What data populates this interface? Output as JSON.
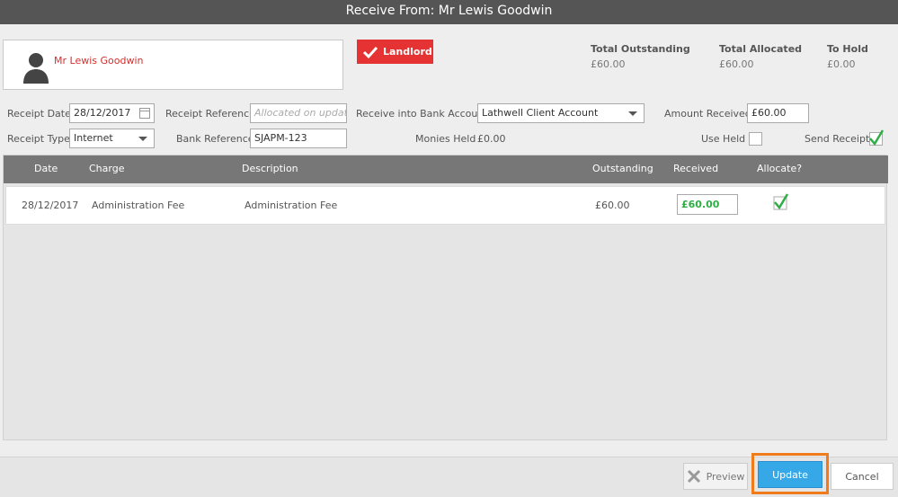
{
  "title": "Receive From: Mr Lewis Goodwin",
  "contact": {
    "name": "Mr Lewis Goodwin",
    "role_badge": "Landlord"
  },
  "summary": {
    "total_outstanding": {
      "label": "Total Outstanding",
      "value": "£60.00"
    },
    "total_allocated": {
      "label": "Total Allocated",
      "value": "£60.00"
    },
    "to_hold": {
      "label": "To Hold",
      "value": "£0.00"
    }
  },
  "form": {
    "receipt_date": {
      "label": "Receipt Date",
      "value": "28/12/2017"
    },
    "receipt_reference": {
      "label": "Receipt Reference",
      "placeholder": "Allocated on update"
    },
    "bank_account": {
      "label": "Receive into Bank Account",
      "value": "Lathwell Client Account"
    },
    "amount_received": {
      "label": "Amount Received",
      "value": "£60.00"
    },
    "receipt_type": {
      "label": "Receipt Type",
      "value": "Internet"
    },
    "bank_reference": {
      "label": "Bank Reference",
      "value": "SJAPM-123"
    },
    "monies_held": {
      "label": "Monies Held",
      "value": "£0.00"
    },
    "use_held": {
      "label": "Use Held",
      "checked": false
    },
    "send_receipt": {
      "label": "Send Receipt",
      "checked": true
    }
  },
  "table": {
    "columns": [
      "Date",
      "Charge",
      "Description",
      "Outstanding",
      "Received",
      "Allocate?"
    ],
    "rows": [
      {
        "date": "28/12/2017",
        "charge": "Administration Fee",
        "description": "Administration Fee",
        "outstanding": "£60.00",
        "received": "£60.00",
        "allocate": true
      }
    ]
  },
  "buttons": {
    "preview": "Preview",
    "update": "Update",
    "cancel": "Cancel"
  },
  "colors": {
    "accent": "#36a8e8",
    "badge": "#e53333",
    "highlight": "#f07b1b",
    "tick": "#2eae44"
  },
  "icons": [
    "avatar-icon",
    "checkmark-icon",
    "calendar-icon",
    "chevron-down-icon",
    "close-icon"
  ]
}
